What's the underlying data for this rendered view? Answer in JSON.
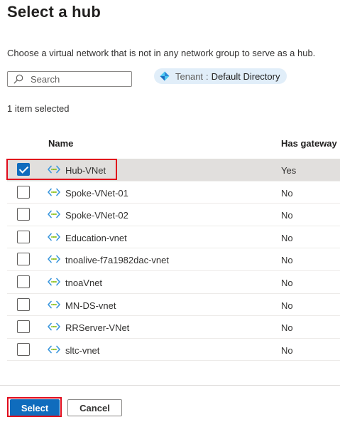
{
  "panel": {
    "title": "Select a hub",
    "description": "Choose a virtual network that is not in any network group to serve as a hub.",
    "search": {
      "placeholder": "Search",
      "value": ""
    },
    "tenant": {
      "label": "Tenant",
      "separator": ":",
      "value": "Default Directory"
    },
    "selection_count": "1 item selected"
  },
  "table": {
    "columns": [
      "Name",
      "Has gateway"
    ],
    "rows": [
      {
        "name": "Hub-VNet",
        "has_gateway": "Yes",
        "selected": true
      },
      {
        "name": "Spoke-VNet-01",
        "has_gateway": "No",
        "selected": false
      },
      {
        "name": "Spoke-VNet-02",
        "has_gateway": "No",
        "selected": false
      },
      {
        "name": "Education-vnet",
        "has_gateway": "No",
        "selected": false
      },
      {
        "name": "tnoalive-f7a1982dac-vnet",
        "has_gateway": "No",
        "selected": false
      },
      {
        "name": "tnoaVnet",
        "has_gateway": "No",
        "selected": false
      },
      {
        "name": "MN-DS-vnet",
        "has_gateway": "No",
        "selected": false
      },
      {
        "name": "RRServer-VNet",
        "has_gateway": "No",
        "selected": false
      },
      {
        "name": "sltc-vnet",
        "has_gateway": "No",
        "selected": false
      }
    ]
  },
  "footer": {
    "select_label": "Select",
    "cancel_label": "Cancel"
  },
  "icons": {
    "search": "search-icon",
    "tenant": "azure-ad-diamond-icon",
    "vnet": "virtual-network-icon",
    "checkbox_checked": "checkmark-icon"
  },
  "colors": {
    "accent": "#0f6cbd",
    "highlight": "#e00b1c",
    "selected_row": "#e1dfdd",
    "tenant_pill": "#e1eef9",
    "vnet_icon": "#3a96dd"
  }
}
